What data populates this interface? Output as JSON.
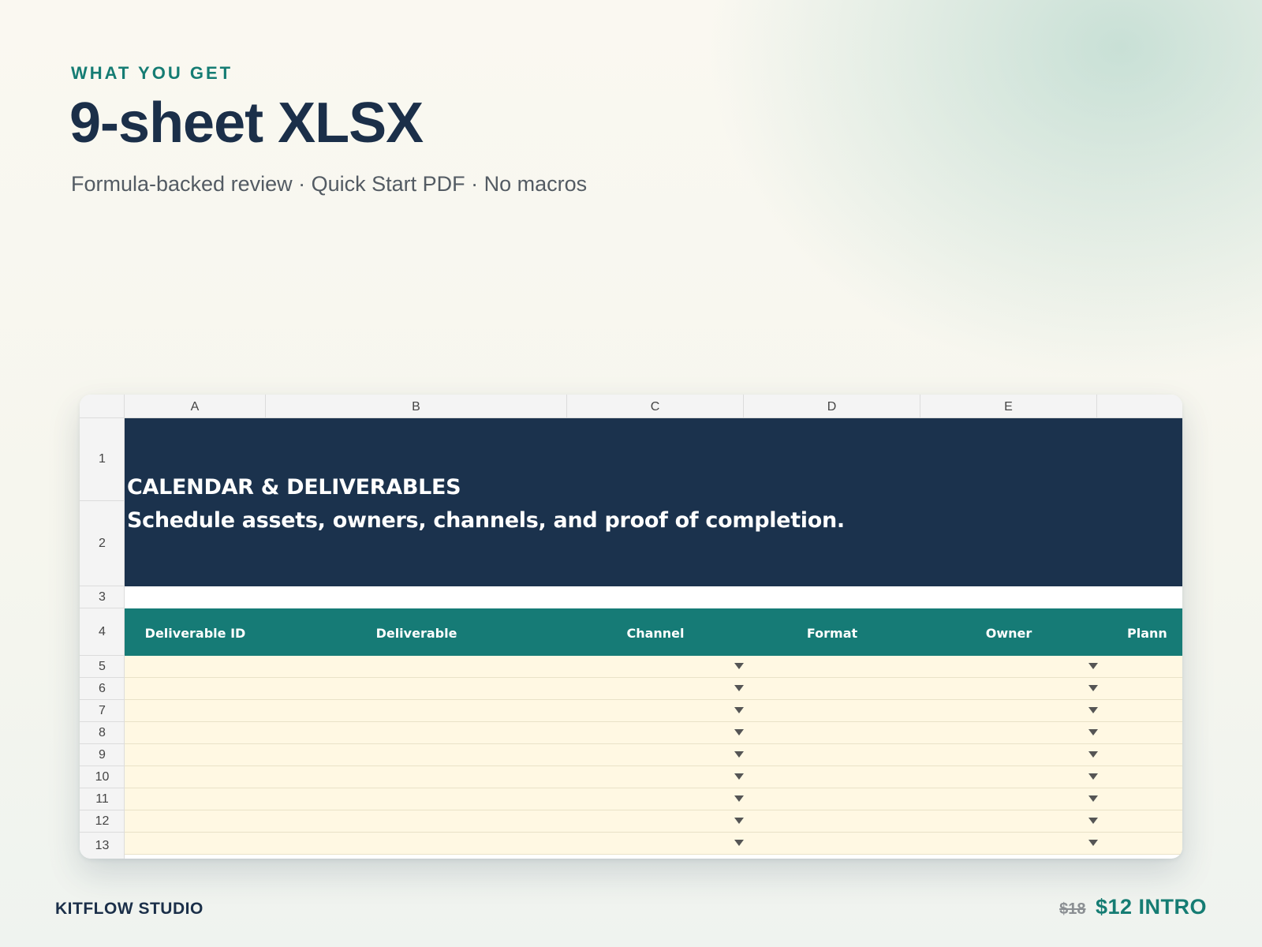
{
  "hero": {
    "eyebrow": "WHAT YOU GET",
    "headline": "9-sheet XLSX",
    "subline": "Formula-backed review · Quick Start PDF · No macros"
  },
  "sheet": {
    "columns": [
      "A",
      "B",
      "C",
      "D",
      "E",
      ""
    ],
    "banner_title": "CALENDAR & DELIVERABLES",
    "banner_subtitle": "Schedule assets, owners, channels, and proof of completion.",
    "header_cells": [
      "Deliverable ID",
      "Deliverable",
      "Channel",
      "Format",
      "Owner",
      "Plann"
    ],
    "row_numbers": [
      "1",
      "2",
      "3",
      "4",
      "5",
      "6",
      "7",
      "8",
      "9",
      "10",
      "11",
      "12",
      "13"
    ],
    "data_row_count": 9,
    "colors": {
      "banner": "#1b324d",
      "header": "#167b76",
      "input_fill": "#fff8e3",
      "accent": "#157c73",
      "navy": "#1b2f49"
    }
  },
  "footer": {
    "brand": "KITFLOW STUDIO",
    "price_old": "$18",
    "price_new": "$12 INTRO"
  }
}
